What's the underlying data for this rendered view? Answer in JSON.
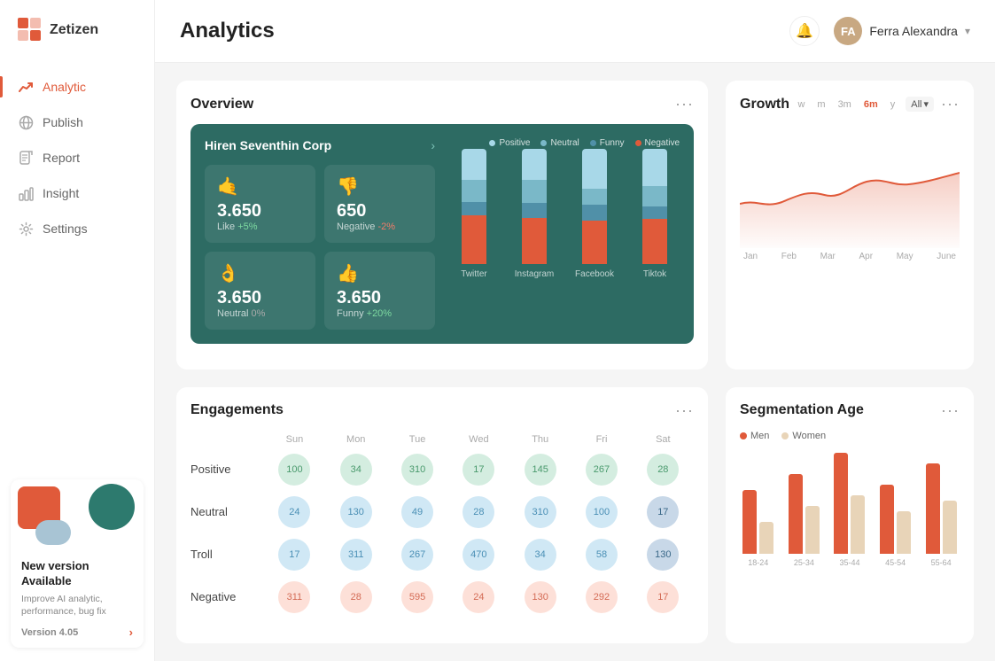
{
  "app": {
    "logo_text": "Zetizen",
    "header_title": "Analytics",
    "user_name": "Ferra Alexandra"
  },
  "sidebar": {
    "nav_items": [
      {
        "label": "Analytic",
        "icon": "trend-up",
        "active": true
      },
      {
        "label": "Publish",
        "icon": "globe",
        "active": false
      },
      {
        "label": "Report",
        "icon": "file",
        "active": false
      },
      {
        "label": "Insight",
        "icon": "bar-chart",
        "active": false
      },
      {
        "label": "Settings",
        "icon": "settings",
        "active": false
      }
    ],
    "promo": {
      "title": "New version Available",
      "description": "Improve AI analytic, performance, bug fix",
      "version_label": "Version 4.05"
    }
  },
  "overview": {
    "title": "Overview",
    "company": "Hiren Seventhin Corp",
    "stats": [
      {
        "icon": "🤙",
        "value": "3.650",
        "label": "Like",
        "change": "+5%",
        "type": "positive"
      },
      {
        "icon": "👎",
        "value": "650",
        "label": "Negative",
        "change": "-2%",
        "type": "negative"
      },
      {
        "icon": "👌",
        "value": "3.650",
        "label": "Neutral",
        "change": "0%",
        "type": "neutral"
      },
      {
        "icon": "👍",
        "value": "3.650",
        "label": "Funny",
        "change": "+20%",
        "type": "positive"
      }
    ],
    "legend": [
      {
        "label": "Positive",
        "color": "#a8d8e8"
      },
      {
        "label": "Neutral",
        "color": "#7ab8c8"
      },
      {
        "label": "Funny",
        "color": "#5090a8"
      },
      {
        "label": "Negative",
        "color": "#e05a3a"
      }
    ],
    "bars": [
      {
        "label": "Twitter",
        "positive": 35,
        "neutral": 25,
        "funny": 15,
        "negative": 55
      },
      {
        "label": "Instagram",
        "positive": 40,
        "neutral": 30,
        "funny": 20,
        "negative": 60
      },
      {
        "label": "Facebook",
        "positive": 50,
        "neutral": 20,
        "funny": 20,
        "negative": 55
      },
      {
        "label": "Tiktok",
        "positive": 45,
        "neutral": 25,
        "funny": 15,
        "negative": 55
      }
    ]
  },
  "growth": {
    "title": "Growth",
    "time_filters": [
      "w",
      "m",
      "3m",
      "6m",
      "y"
    ],
    "active_filter": "6m",
    "dropdown_label": "All",
    "x_labels": [
      "Jan",
      "Feb",
      "Mar",
      "Apr",
      "May",
      "June"
    ]
  },
  "engagements": {
    "title": "Engagements",
    "rows": [
      {
        "label": "Positive",
        "values": [
          "100",
          "34",
          "310",
          "17",
          "145",
          "267",
          "28"
        ],
        "colors": [
          "green",
          "green",
          "green",
          "green",
          "green",
          "green",
          "green"
        ]
      },
      {
        "label": "Neutral",
        "values": [
          "24",
          "130",
          "49",
          "28",
          "310",
          "100",
          "17"
        ],
        "colors": [
          "blue",
          "blue",
          "blue",
          "blue",
          "blue",
          "blue",
          "dark"
        ]
      },
      {
        "label": "Troll",
        "values": [
          "17",
          "311",
          "267",
          "470",
          "34",
          "58",
          "130"
        ],
        "colors": [
          "blue",
          "blue",
          "blue",
          "blue",
          "blue",
          "blue",
          "dark"
        ]
      },
      {
        "label": "Negative",
        "values": [
          "311",
          "28",
          "595",
          "24",
          "130",
          "292",
          "17"
        ],
        "colors": [
          "salmon",
          "salmon",
          "salmon",
          "salmon",
          "salmon",
          "salmon",
          "salmon"
        ]
      }
    ],
    "col_headers": [
      "Sun",
      "Mon",
      "Tue",
      "Wed",
      "Thu",
      "Fri",
      "Sat"
    ]
  },
  "segmentation": {
    "title": "Segmentation Age",
    "legend": [
      {
        "label": "Men",
        "color": "#e05a3a"
      },
      {
        "label": "Women",
        "color": "#e8d4b8"
      }
    ],
    "groups": [
      {
        "label": "18-24",
        "men": 60,
        "women": 30
      },
      {
        "label": "25-34",
        "men": 75,
        "women": 45
      },
      {
        "label": "35-44",
        "men": 95,
        "women": 55
      },
      {
        "label": "45-54",
        "men": 65,
        "women": 40
      },
      {
        "label": "55-64",
        "men": 85,
        "women": 50
      }
    ]
  }
}
